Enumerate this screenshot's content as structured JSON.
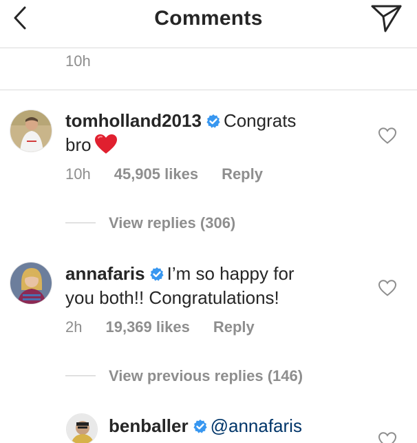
{
  "header": {
    "title": "Comments"
  },
  "previous_comment": {
    "time": "10h"
  },
  "comments": [
    {
      "username": "tomholland2013",
      "verified": true,
      "text_line1": "Congrats",
      "text_line2": "bro",
      "emoji": "red-heart",
      "time": "10h",
      "likes": "45,905 likes",
      "reply": "Reply",
      "replies_toggle": "View replies (306)"
    },
    {
      "username": "annafaris",
      "verified": true,
      "text_line1": "I’m so happy for",
      "text_line2": "you both!! Congratulations!",
      "time": "2h",
      "likes": "19,369 likes",
      "reply": "Reply",
      "replies_toggle": "View previous replies (146)"
    }
  ],
  "reply_item": {
    "username": "benballer",
    "verified": true,
    "mention": "@annafaris"
  },
  "colors": {
    "verified_badge": "#3897f0",
    "heart_emoji": "#e0202f",
    "secondary_text": "#8e8e8e",
    "primary_text": "#262626",
    "mention": "#003569"
  },
  "icons": [
    "chevron-left-icon",
    "direct-send-icon",
    "verified-badge-icon",
    "heart-outline-icon",
    "red-heart-emoji"
  ]
}
